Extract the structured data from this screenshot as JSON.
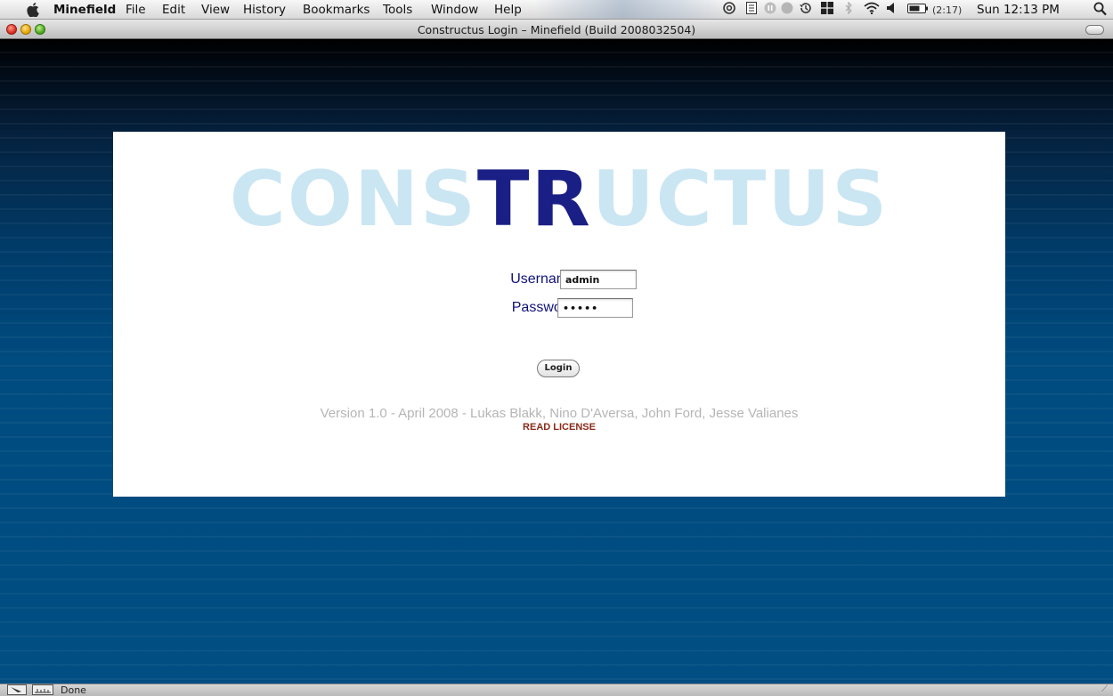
{
  "menubar": {
    "apple_icon": "apple-icon",
    "app_name": "Minefield",
    "items": [
      "File",
      "Edit",
      "View",
      "History",
      "Bookmarks",
      "Tools",
      "Window",
      "Help"
    ],
    "status_icons": [
      "at-icon",
      "notes-icon",
      "pause-icon",
      "record-icon",
      "time-machine-icon",
      "grid-icon",
      "bluetooth-icon",
      "wifi-icon",
      "volume-icon",
      "battery-icon"
    ],
    "battery_time": "(2:17)",
    "clock": "Sun 12:13 PM",
    "spotlight_icon": "spotlight-icon"
  },
  "window": {
    "title": "Constructus Login – Minefield (Build 2008032504)"
  },
  "page": {
    "logo": {
      "text": "CONSTRUCTUS",
      "accent_color": "#1a1f86",
      "light_color": "#cbe6f3"
    },
    "login": {
      "username_label": "Username",
      "username_value": "admin",
      "password_label": "Password",
      "password_value": "•••••",
      "button_label": "Login"
    },
    "credits": "Version 1.0 - April 2008 - Lukas Blakk, Nino D'Aversa, John Ford, Jesse Valianes",
    "license_link": "READ LICENSE"
  },
  "statusbar": {
    "text": "Done"
  },
  "colors": {
    "background": "#004b7f",
    "label": "#10127a",
    "license": "#8a2a1a"
  }
}
